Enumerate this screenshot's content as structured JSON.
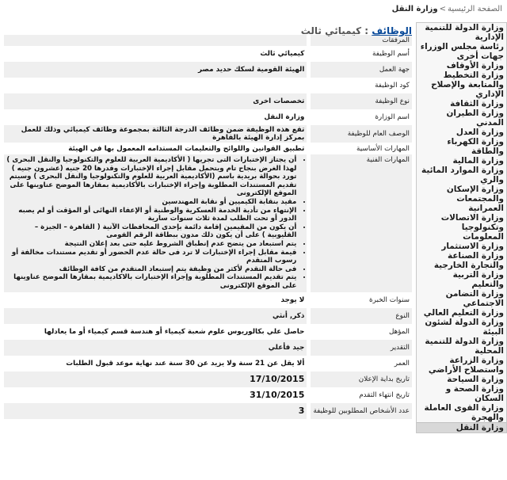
{
  "breadcrumb": {
    "home": "الصفحة الرئيسية",
    "separator": ">",
    "current": "وزارة النقل"
  },
  "sidebar": {
    "items": [
      "وزارة الدولة للتنمية الإدارية",
      "رئاسة مجلس الوزراء",
      "جهات أخرى",
      "وزارة الأوقاف",
      "وزارة التخطيط والمتابعة والإصلاح الإداري",
      "وزارة الثقافة",
      "وزارة الطيران المدني",
      "وزارة العدل",
      "وزارة الكهرباء والطاقة",
      "وزارة المالية",
      "وزارة الموارد المائية والري",
      "وزارة الإسكان والمجتمعات العمرانية",
      "وزارة الاتصالات وتكنولوجيا المعلومات",
      "وزارة الاستثمار",
      "وزارة الصناعة والتجارة الخارجية",
      "وزارة التربية والتعليم",
      "وزارة التضامن الاجتماعي",
      "وزارة التعليم العالي",
      "وزارة الدولة لشئون البيئة",
      "وزارة الدولة للتنمية المحلية",
      "وزارة الزراعة واستصلاح الأراضي",
      "وزارة السياحة",
      "وزارة الصحة و السكان",
      "وزارة القوى العاملة والهجرة",
      "وزارة النقل"
    ],
    "active_index": 24
  },
  "main": {
    "title_link": "الوظائف",
    "title_sep": " : ",
    "title_name": "كيميائي ثالث",
    "rows": {
      "attachments": {
        "label": "المرفقات",
        "value": ""
      },
      "job_name": {
        "label": "أسم الوظيفة",
        "value": "كيميائي ثالث"
      },
      "employer": {
        "label": "جهة العمل",
        "value": "الهيئة القومية لسكك حديد مصر"
      },
      "job_code": {
        "label": "كود الوظيفة",
        "value": ""
      },
      "job_type": {
        "label": "نوع الوظيفة",
        "value": "تخصصات اخرى"
      },
      "ministry": {
        "label": "اسم الوزارة",
        "value": "وزارة النقل"
      },
      "description": {
        "label": "الوصف العام للوظيفة",
        "value": "تقع هذه الوظيفة ضمن وظائف الدرجة الثالثة بمجموعة وظائف كيميائي وذلك للعمل بمركز إدارة الهيئة بالقاهرة"
      },
      "basic_skills": {
        "label": "المهارات الأساسية",
        "value": "تطبيق القوانين واللوائح والتعليمات المستدامه المعمول بها في الهيئة"
      },
      "technical_skills": {
        "label": "المهارات الفنية",
        "items": [
          "أن يجتاز الإختبارات التى تجريها ( الأكاديمية العربية للعلوم والتكنولوجيا والنقل البحرى ) لهذا الغرض بنجاح تام ويتحمل مقابل إجراء الإختبارات وقدرها 20 جنيه (عشرون جنيه ) تورد بحوالة بريدية باسم (الأكاديمية العربية للعلوم والتكنولوجيا والنقل البحرى ) وسيتم تقديم المستندات المطلوبة وإجراء الإختبارات بالأكاديمية بمقارها الموضح عناوينها على الموقع الإلكترونى",
          "مقيد بنقابة الكيميين أو نقابة المهندسين",
          "الإنتهاء من تأدية الخدمة العسكرية والوطنية أو الإعفاء النهائى أو المؤقت أو لم يصبه الدور أو تحت الطلب لمدة ثلاث سنوات سارية",
          "أن يكون من المقيمين إقامة دائمة بإحدى المحافظات الآتية ( القاهرة – الجيزة – القليوبية ) على أن يكون ذلك مدون ببطاقة الرقم القومى",
          "يتم استبعاد من يتضح عدم إنطباق الشروط عليه حتى بعد إعلان النتيجة",
          "قيمة مقابل إجراء الإختبارات لا ترد فى حالة عدم الحضور أو تقديم مستندات مخالفة أو رسوب المتقدم",
          "فى حالة التقدم لأكثر من وظيفة يتم إستبعاد المتقدم من كافة الوظائف",
          "يتم تقديم المستندات المطلوبة وإجراء الإختبارات بالاكاديمية بمقارها الموضح عناوينها على الموقع الإلكترونى"
        ]
      },
      "experience_years": {
        "label": "سنوات الخبرة",
        "value": "لا يوجد"
      },
      "gender": {
        "label": "النوع",
        "value": "ذكر, أنثي"
      },
      "qualification": {
        "label": "المؤهل",
        "value": "حاصل علي بكالوريوس علوم شعبة كيمياء أو هندسة قسم كيمياء أو ما يعادلها"
      },
      "grade": {
        "label": "التقدير",
        "value": "جيد فأعلي"
      },
      "age": {
        "label": "العمر",
        "value": "ألا يقل عن 21 سنة ولا يزيد عن 30 سنة عند نهاية موعد قبول الطلبات"
      },
      "start_date": {
        "label": "تاريخ بداية الإعلان",
        "value": "17/10/2015"
      },
      "end_date": {
        "label": "تاريخ انتهاء التقدم",
        "value": "31/10/2015"
      },
      "required_count": {
        "label": "عدد الأشخاص المطلوبين للوظيفة",
        "value": "3"
      }
    }
  }
}
